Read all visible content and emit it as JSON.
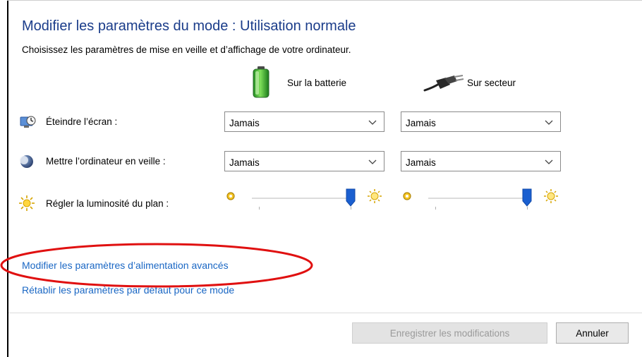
{
  "header": {
    "title": "Modifier les paramètres du mode : Utilisation normale",
    "subtitle": "Choisissez les paramètres de mise en veille et d’affichage de votre ordinateur."
  },
  "columns": {
    "battery": "Sur la batterie",
    "plugged": "Sur secteur"
  },
  "rows": {
    "screen_off": {
      "label": "Éteindre l’écran :",
      "battery_value": "Jamais",
      "plugged_value": "Jamais"
    },
    "sleep": {
      "label": "Mettre l’ordinateur en veille :",
      "battery_value": "Jamais",
      "plugged_value": "Jamais"
    },
    "brightness": {
      "label": "Régler la luminosité du plan :",
      "battery_level": 1.0,
      "plugged_level": 1.0
    }
  },
  "links": {
    "advanced": "Modifier les paramètres d’alimentation avancés",
    "restore": "Rétablir les paramètres par défaut pour ce mode"
  },
  "buttons": {
    "save": "Enregistrer les modifications",
    "cancel": "Annuler"
  },
  "colors": {
    "title": "#1a3c8a",
    "link": "#1a67c4",
    "highlight_oval": "#e01010",
    "slider_thumb": "#1a5fd0"
  }
}
